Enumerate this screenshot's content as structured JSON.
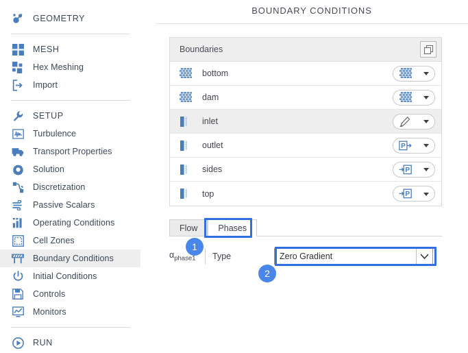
{
  "sidebar": {
    "groups": [
      {
        "items": [
          {
            "label": "GEOMETRY",
            "icon": "geometry-icon",
            "group": true,
            "selected": false
          }
        ]
      },
      {
        "items": [
          {
            "label": "MESH",
            "icon": "mesh-icon",
            "group": true,
            "selected": false
          },
          {
            "label": "Hex Meshing",
            "icon": "hex-meshing-icon",
            "group": false,
            "selected": false
          },
          {
            "label": "Import",
            "icon": "import-icon",
            "group": false,
            "selected": false
          }
        ]
      },
      {
        "items": [
          {
            "label": "SETUP",
            "icon": "wrench-icon",
            "group": true,
            "selected": false
          },
          {
            "label": "Turbulence",
            "icon": "turbulence-icon",
            "group": false,
            "selected": false
          },
          {
            "label": "Transport Properties",
            "icon": "truck-icon",
            "group": false,
            "selected": false
          },
          {
            "label": "Solution",
            "icon": "gear-icon",
            "group": false,
            "selected": false
          },
          {
            "label": "Discretization",
            "icon": "discretization-icon",
            "group": false,
            "selected": false
          },
          {
            "label": "Passive Scalars",
            "icon": "wind-icon",
            "group": false,
            "selected": false
          },
          {
            "label": "Operating Conditions",
            "icon": "bar-chart-icon",
            "group": false,
            "selected": false
          },
          {
            "label": "Cell Zones",
            "icon": "cell-zones-icon",
            "group": false,
            "selected": false
          },
          {
            "label": "Boundary Conditions",
            "icon": "barrier-icon",
            "group": false,
            "selected": true
          },
          {
            "label": "Initial Conditions",
            "icon": "power-icon",
            "group": false,
            "selected": false
          },
          {
            "label": "Controls",
            "icon": "save-icon",
            "group": false,
            "selected": false
          },
          {
            "label": "Monitors",
            "icon": "monitor-icon",
            "group": false,
            "selected": false
          }
        ]
      },
      {
        "items": [
          {
            "label": "RUN",
            "icon": "play-icon",
            "group": true,
            "selected": false
          }
        ]
      }
    ]
  },
  "header": {
    "title": "BOUNDARY CONDITIONS"
  },
  "boundaries_panel": {
    "header_label": "Boundaries",
    "copy_icon": "copy-icon",
    "rows": [
      {
        "name": "bottom",
        "row_icon": "wall-icon",
        "type_icon": "wall-icon",
        "selected": false
      },
      {
        "name": "dam",
        "row_icon": "wall-icon",
        "type_icon": "wall-icon",
        "selected": false
      },
      {
        "name": "inlet",
        "row_icon": "patch-icon",
        "type_icon": "pencil-icon",
        "selected": true
      },
      {
        "name": "outlet",
        "row_icon": "patch-icon",
        "type_icon": "pressure-out-icon",
        "selected": false
      },
      {
        "name": "sides",
        "row_icon": "patch-icon",
        "type_icon": "pressure-in-icon",
        "selected": false
      },
      {
        "name": "top",
        "row_icon": "patch-icon",
        "type_icon": "pressure-in-icon",
        "selected": false
      }
    ]
  },
  "tabs": [
    {
      "label": "Flow",
      "active": false
    },
    {
      "label": "Phases",
      "active": true
    }
  ],
  "form": {
    "phase_symbol": "α",
    "phase_subscript": "phase1",
    "type_label": "Type",
    "type_value": "Zero Gradient",
    "type_options": [
      "Zero Gradient"
    ]
  },
  "annotations": [
    {
      "badge": "1"
    },
    {
      "badge": "2"
    }
  ],
  "colors": {
    "accent_blue": "#4a86e8",
    "annotation_blue": "#2f6fe0",
    "icon_blue": "#4a7ebb",
    "selected_row": "#eeeeee"
  }
}
